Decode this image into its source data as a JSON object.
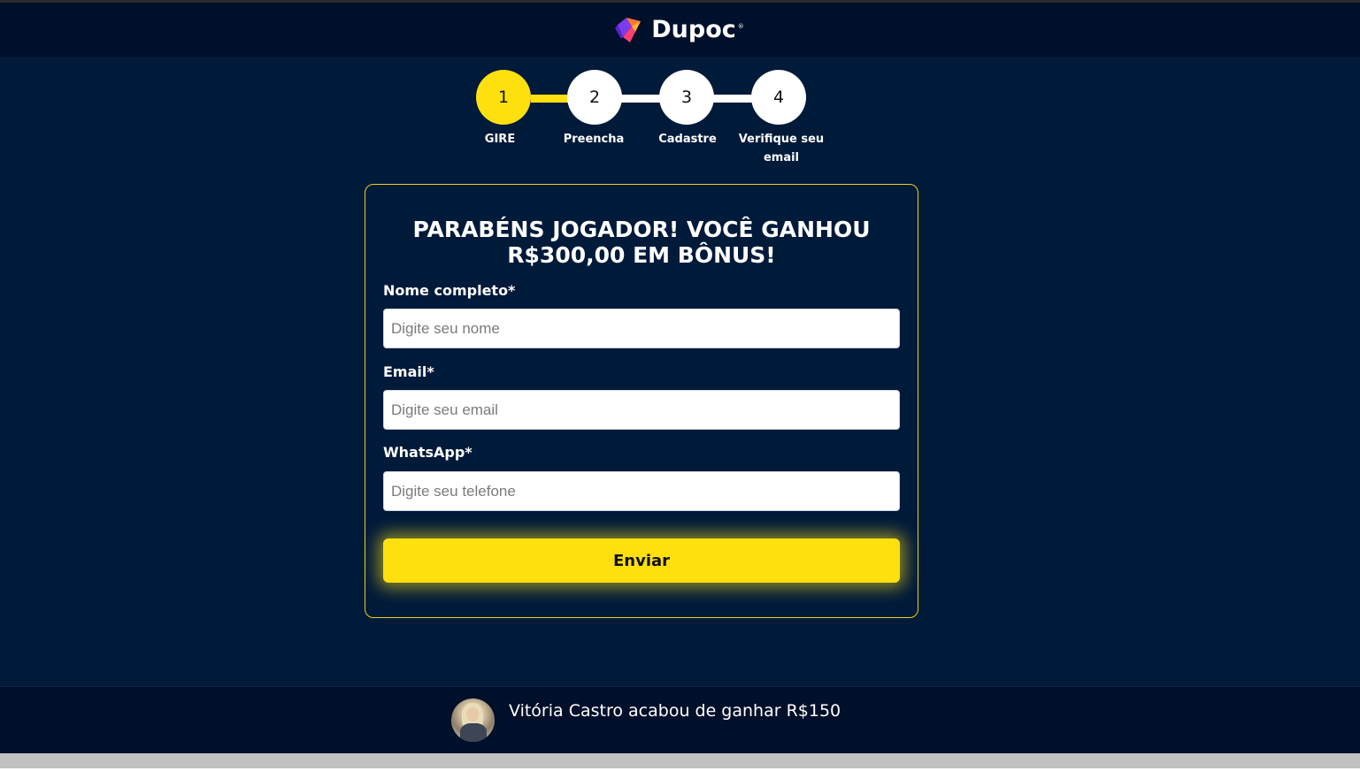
{
  "brand": {
    "name": "Dupoc",
    "registered": "®"
  },
  "steps": [
    {
      "number": "1",
      "label": "GIRE",
      "active": true
    },
    {
      "number": "2",
      "label": "Preencha",
      "active": false
    },
    {
      "number": "3",
      "label": "Cadastre",
      "active": false
    },
    {
      "number": "4",
      "label": "Verifique seu email",
      "active": false
    }
  ],
  "form": {
    "title": "PARABÉNS JOGADOR! VOCÊ GANHOU R$300,00 EM BÔNUS!",
    "name_label": "Nome completo*",
    "name_placeholder": "Digite seu nome",
    "email_label": "Email*",
    "email_placeholder": "Digite seu email",
    "phone_label": "WhatsApp*",
    "phone_placeholder": "Digite seu telefone",
    "submit_label": "Enviar"
  },
  "footer": {
    "notice": "Vitória Castro acabou de ganhar R$150"
  },
  "colors": {
    "accent": "#ffe00f",
    "background": "#001a3a",
    "header": "#000f2a"
  }
}
